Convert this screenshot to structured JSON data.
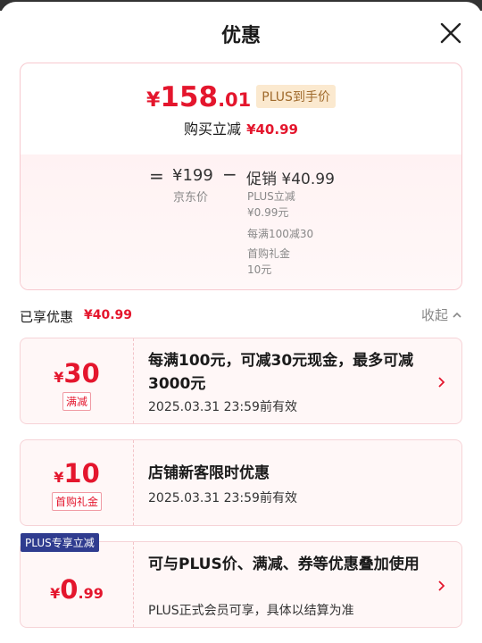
{
  "header": {
    "title": "优惠"
  },
  "price_card": {
    "currency": "¥",
    "plus_price_int": "158",
    "plus_price_dec": ".01",
    "plus_tag": "PLUS到手价",
    "instant_label": "购买立减",
    "instant_amount": "¥40.99",
    "eq_sign": "=",
    "jd_price": "¥199",
    "jd_label": "京东价",
    "minus_sign": "−",
    "promo_title": "促销 ¥40.99",
    "promo_details": [
      "PLUS立减",
      "¥0.99元",
      "每满100减30",
      "首购礼金",
      "10元"
    ]
  },
  "enjoyed": {
    "label": "已享优惠",
    "amount": "¥40.99",
    "collapse_label": "收起"
  },
  "coupons": [
    {
      "currency": "¥",
      "value": "30",
      "decimal": "",
      "type": "满减",
      "title": "每满100元，可减30元现金，最多可减3000元",
      "subtitle": "2025.03.31 23:59前有效",
      "badge": ""
    },
    {
      "currency": "¥",
      "value": "10",
      "decimal": "",
      "type": "首购礼金",
      "title": "店铺新客限时优惠",
      "subtitle": "2025.03.31 23:59前有效",
      "badge": ""
    },
    {
      "currency": "¥",
      "value": "0",
      "decimal": ".99",
      "type": "",
      "title": "可与PLUS价、满减、券等优惠叠加使用",
      "subtitle": "PLUS正式会员可享，具体以结算为准",
      "badge": "PLUS专享立减"
    }
  ],
  "colors": {
    "accent": "#e4162d",
    "plus_badge": "#2f3c8f",
    "plus_tag_bg": "#fbe9cf"
  },
  "icons": {
    "close": "close-icon",
    "chevron_up": "chevron-up-icon",
    "chevron_right": "chevron-right-icon"
  }
}
